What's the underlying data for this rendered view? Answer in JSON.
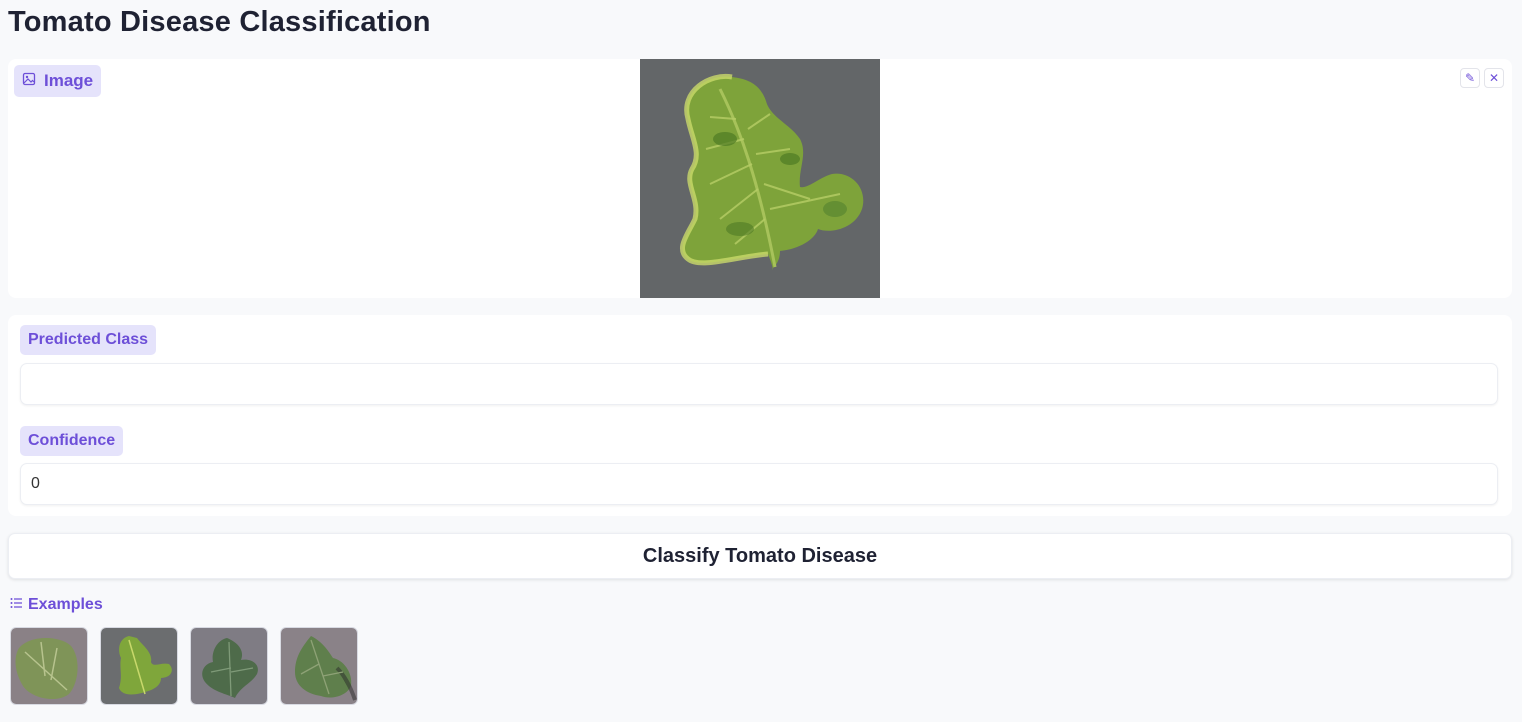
{
  "app": {
    "title": "Tomato Disease Classification"
  },
  "image_input": {
    "label": "Image",
    "label_icon": "image-icon",
    "tools": [
      {
        "name": "edit",
        "icon": "pencil-icon",
        "glyph": "✎"
      },
      {
        "name": "clear",
        "icon": "close-icon",
        "glyph": "✕"
      }
    ]
  },
  "outputs": {
    "predicted_class": {
      "label": "Predicted Class",
      "value": ""
    },
    "confidence": {
      "label": "Confidence",
      "value": "0"
    }
  },
  "submit": {
    "label": "Classify Tomato Disease"
  },
  "examples": {
    "label": "Examples",
    "icon": "list-icon",
    "items": [
      {
        "icon": "leaf-thumbnail"
      },
      {
        "icon": "leaf-thumbnail"
      },
      {
        "icon": "leaf-thumbnail"
      },
      {
        "icon": "leaf-thumbnail"
      }
    ]
  },
  "colors": {
    "accent": "#6d4fd8",
    "badge_bg": "#e5e3fb",
    "page_bg": "#f8f9fb"
  }
}
